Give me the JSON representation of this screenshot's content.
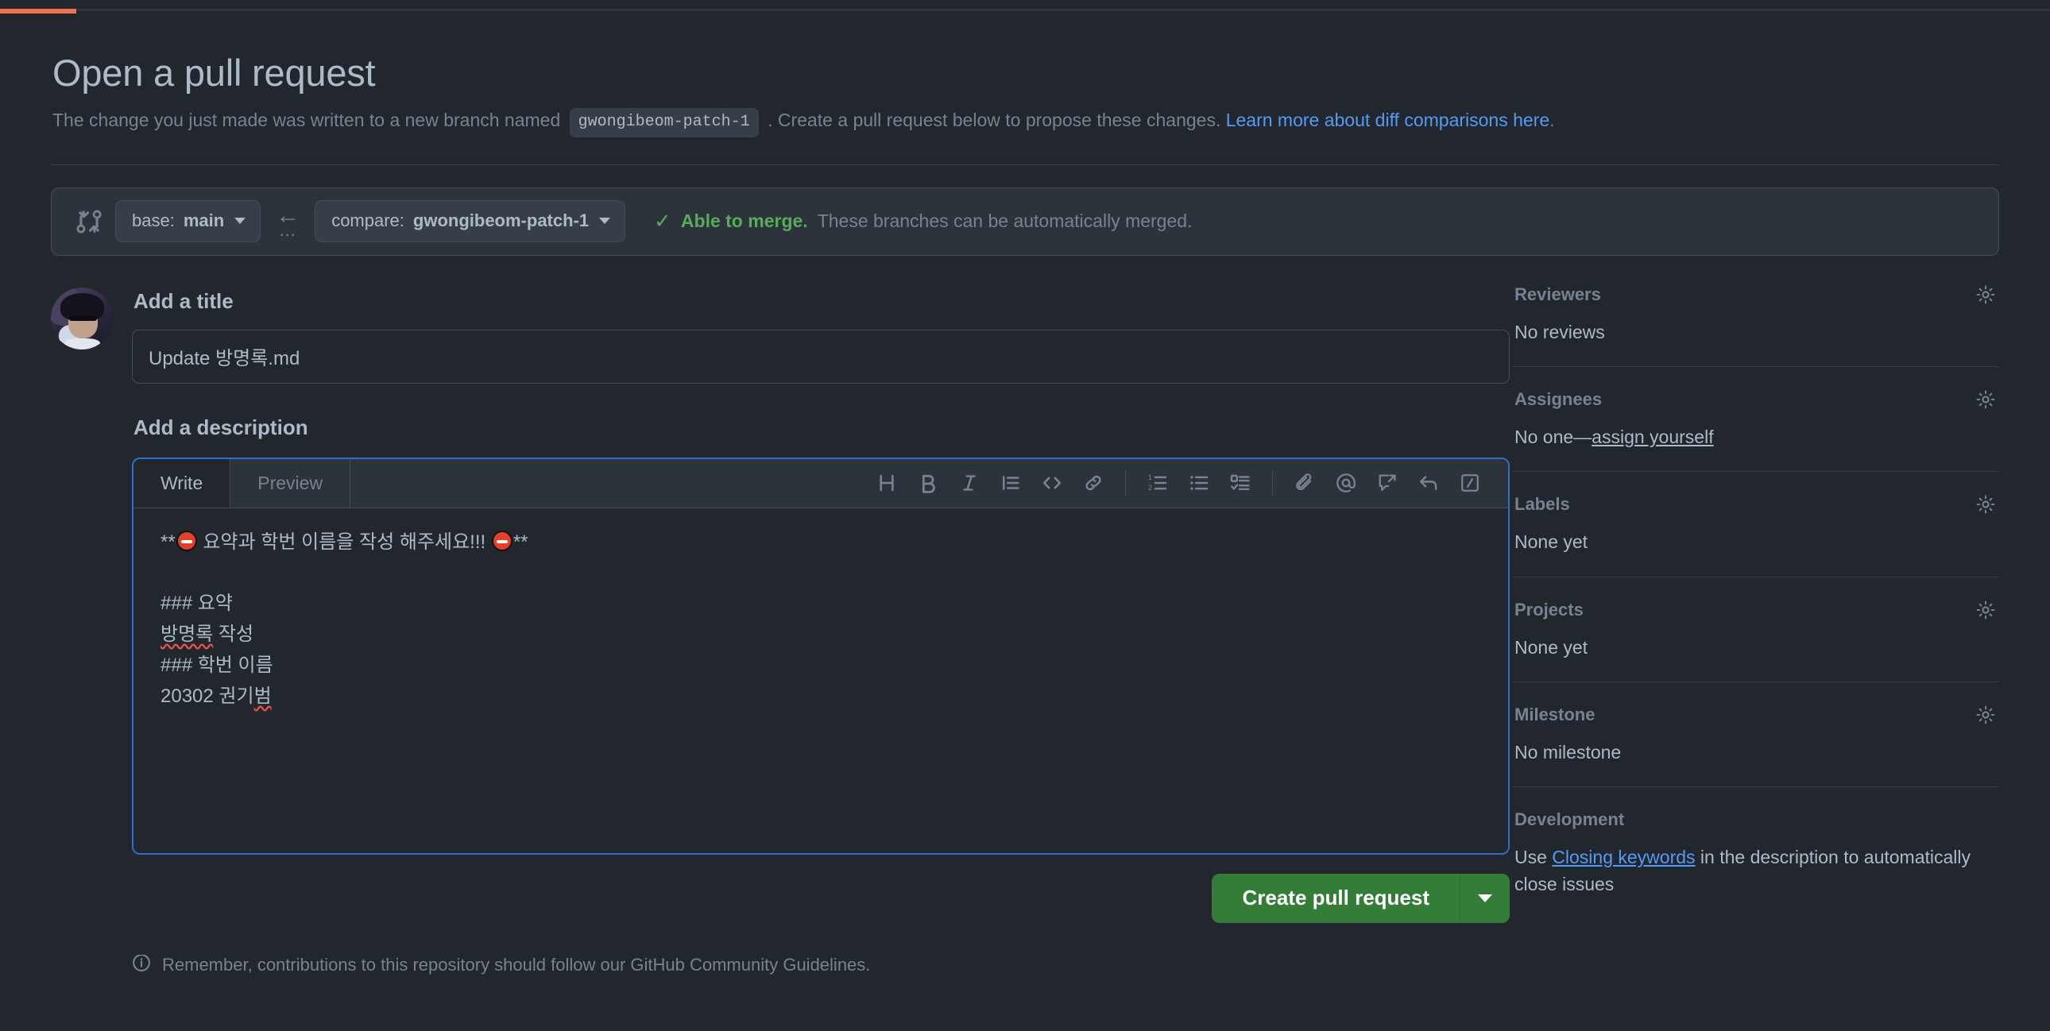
{
  "page": {
    "title": "Open a pull request",
    "subtitle_pre": "The change you just made was written to a new branch named",
    "branch_chip": "gwongibeom-patch-1",
    "subtitle_mid": ". Create a pull request below to propose these changes.",
    "subtitle_link": "Learn more about diff comparisons here",
    "subtitle_end": "."
  },
  "branch_bar": {
    "base_label": "base:",
    "base_branch": "main",
    "compare_label": "compare:",
    "compare_branch": "gwongibeom-patch-1",
    "arrow": "←",
    "dots": "…",
    "merge_check": "✓",
    "merge_status": "Able to merge.",
    "merge_detail": "These branches can be automatically merged."
  },
  "form": {
    "title_section_label": "Add a title",
    "title_value": "Update 방명록.md",
    "description_section_label": "Add a description",
    "tabs": [
      {
        "label": "Write",
        "active": true
      },
      {
        "label": "Preview",
        "active": false
      }
    ],
    "toolbar": [
      {
        "name": "heading-icon",
        "glyph": "H"
      },
      {
        "name": "bold-icon",
        "glyph": "B"
      },
      {
        "name": "italic-icon",
        "glyph": "I"
      },
      {
        "name": "quote-icon",
        "glyph": "quote"
      },
      {
        "name": "code-icon",
        "glyph": "<>"
      },
      {
        "name": "link-icon",
        "glyph": "link"
      },
      {
        "name": "ordered-list-icon",
        "glyph": "1."
      },
      {
        "name": "unordered-list-icon",
        "glyph": "•"
      },
      {
        "name": "task-list-icon",
        "glyph": "task"
      },
      {
        "name": "attach-file-icon",
        "glyph": "paperclip"
      },
      {
        "name": "mention-icon",
        "glyph": "@"
      },
      {
        "name": "saved-replies-icon",
        "glyph": "reply-box"
      },
      {
        "name": "reply-icon",
        "glyph": "arrow-reply"
      },
      {
        "name": "slash-commands-icon",
        "glyph": "slash-box"
      }
    ],
    "description_lines": {
      "line1_a": "**",
      "line1_b": " 요약과 학번 이름을 작성 해주세요!!! ",
      "line1_c": "**",
      "line2": "",
      "line3": "### 요약",
      "line4_misspelled": "방명록",
      "line4_rest": " 작성",
      "line5": "### 학번 이름",
      "line6_a": "20302 권기",
      "line6_misspelled": "범"
    },
    "submit_button": "Create pull request"
  },
  "footer": {
    "note": "Remember, contributions to this repository should follow our GitHub Community Guidelines."
  },
  "sidebar": {
    "sections": [
      {
        "title": "Reviewers",
        "value": "No reviews"
      },
      {
        "title": "Assignees",
        "value_prefix": "No one—",
        "value_link": "assign yourself"
      },
      {
        "title": "Labels",
        "value": "None yet"
      },
      {
        "title": "Projects",
        "value": "None yet"
      },
      {
        "title": "Milestone",
        "value": "No milestone"
      },
      {
        "title": "Development",
        "dev_pre": "Use ",
        "dev_link": "Closing keywords",
        "dev_post": " in the description to automatically close issues"
      }
    ]
  },
  "colors": {
    "background": "#22272e",
    "surface": "#2d333b",
    "border": "#444c56",
    "text_primary": "#adbac7",
    "text_muted": "#768390",
    "accent_blue": "#539bf5",
    "focus_blue": "#316dca",
    "success_green": "#57ab5a",
    "button_green": "#347d39",
    "progress_orange": "#f0734e",
    "error_red": "#e5534b"
  }
}
